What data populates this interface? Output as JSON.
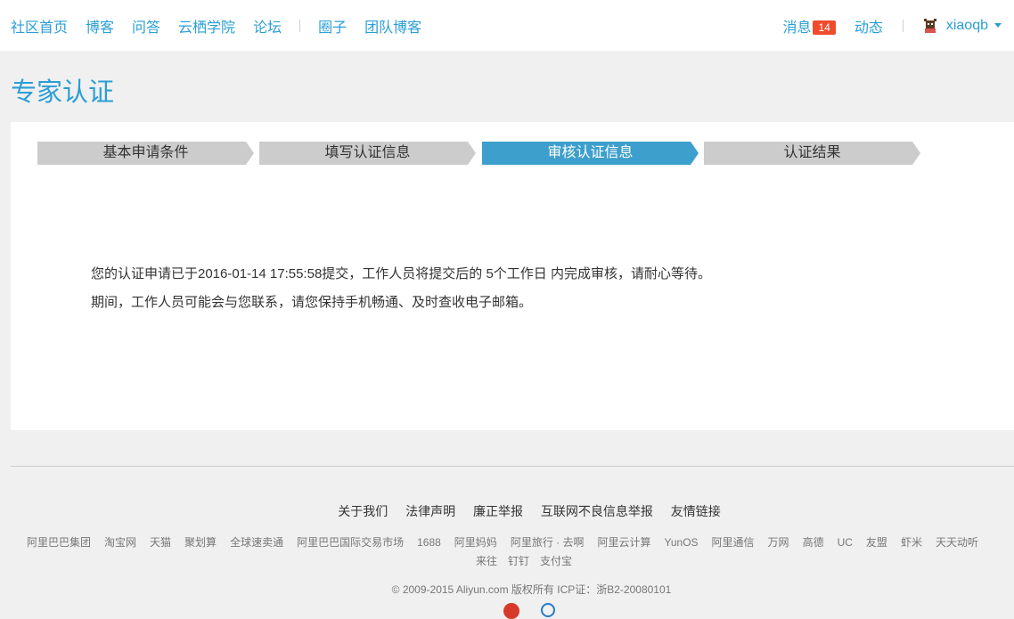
{
  "nav": {
    "left": [
      "社区首页",
      "博客",
      "问答",
      "云栖学院",
      "论坛"
    ],
    "left2": [
      "圈子",
      "团队博客"
    ],
    "messages_label": "消息",
    "messages_count": "14",
    "activity_label": "动态",
    "username": "xiaoqb"
  },
  "page_title": "专家认证",
  "steps": [
    "基本申请条件",
    "填写认证信息",
    "审核认证信息",
    "认证结果"
  ],
  "active_step": "审核认证信息",
  "message": {
    "line1": "您的认证申请已于2016-01-14 17:55:58提交，工作人员将提交后的 5个工作日 内完成审核，请耐心等待。",
    "line2": "期间，工作人员可能会与您联系，请您保持手机畅通、及时查收电子邮箱。"
  },
  "footer": {
    "links": [
      "关于我们",
      "法律声明",
      "廉正举报",
      "互联网不良信息举报",
      "友情链接"
    ],
    "partners": [
      "阿里巴巴集团",
      "淘宝网",
      "天猫",
      "聚划算",
      "全球速卖通",
      "阿里巴巴国际交易市场",
      "1688",
      "阿里妈妈",
      "阿里旅行 · 去啊",
      "阿里云计算",
      "YunOS",
      "阿里通信",
      "万网",
      "高德",
      "UC",
      "友盟",
      "虾米",
      "天天动听"
    ],
    "partners2": [
      "来往",
      "钉钉",
      "支付宝"
    ],
    "copyright": "© 2009-2015 Aliyun.com 版权所有 ICP证：浙B2-20080101"
  },
  "colors": {
    "accent": "#2a9ed6",
    "active_step": "#3d9fcb",
    "badge": "#f04b2d"
  }
}
